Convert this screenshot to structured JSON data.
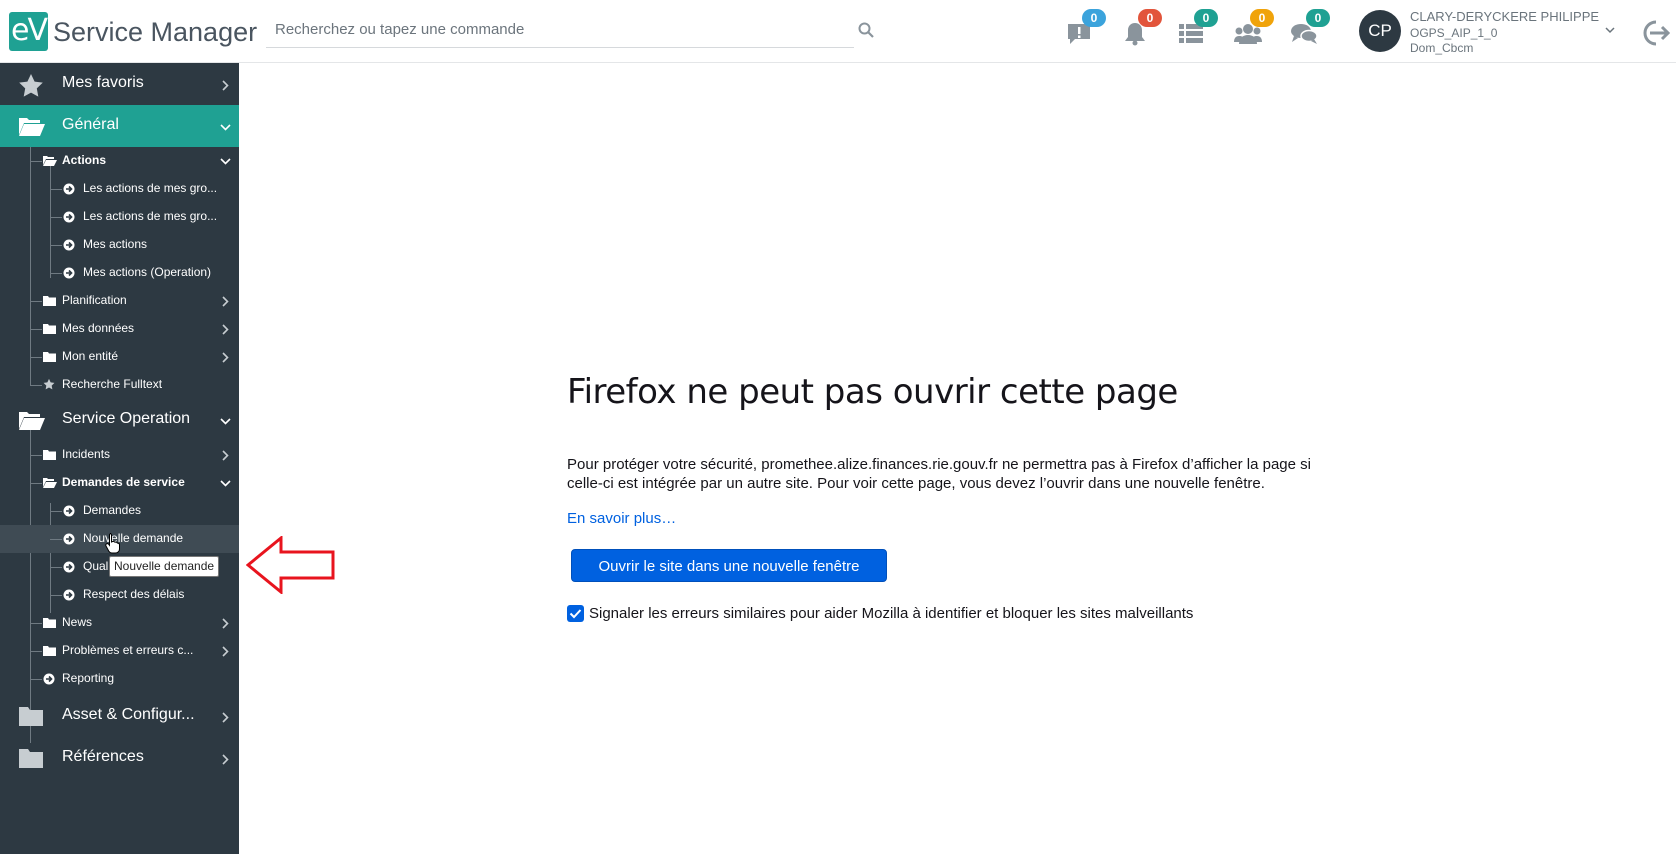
{
  "header": {
    "logo_text": "eV",
    "app_title": "Service Manager",
    "search_placeholder": "Recherchez ou tapez une commande",
    "notifications": [
      {
        "icon": "alert-bubble-icon",
        "count": "0",
        "color": "#3ba3dc"
      },
      {
        "icon": "bell-icon",
        "count": "0",
        "color": "#e2543b"
      },
      {
        "icon": "list-icon",
        "count": "0",
        "color": "#1fa193"
      },
      {
        "icon": "users-icon",
        "count": "0",
        "color": "#f0a30a"
      },
      {
        "icon": "chat-icon",
        "count": "0",
        "color": "#1fa193"
      }
    ],
    "user": {
      "initials": "CP",
      "name": "CLARY-DERYCKERE PHILIPPE",
      "line2": "OGPS_AIP_1_0",
      "line3": "Dom_Cbcm"
    }
  },
  "sidebar": {
    "favorites": "Mes favoris",
    "general": "Général",
    "actions": "Actions",
    "actions_items": [
      "Les actions de mes gro...",
      "Les actions de mes gro...",
      "Mes actions",
      "Mes actions (Operation)"
    ],
    "planification": "Planification",
    "mes_donnees": "Mes données",
    "mon_entite": "Mon entité",
    "recherche": "Recherche Fulltext",
    "service_operation": "Service Operation",
    "incidents": "Incidents",
    "demandes_service": "Demandes de service",
    "demandes": "Demandes",
    "nouvelle_demande": "Nouvelle demande",
    "qualite": "Qual",
    "respect": "Respect des délais",
    "news": "News",
    "problemes": "Problèmes et erreurs c...",
    "reporting": "Reporting",
    "asset": "Asset & Configur...",
    "references": "Références"
  },
  "tooltip": "Nouvelle demande",
  "error_page": {
    "title": "Firefox ne peut pas ouvrir cette page",
    "text": "Pour protéger votre sécurité, promethee.alize.finances.rie.gouv.fr ne permettra pas à Firefox d’afficher la page si celle-ci est intégrée par un autre site. Pour voir cette page, vous devez l’ouvrir dans une nouvelle fenêtre.",
    "link": "En savoir plus…",
    "button": "Ouvrir le site dans une nouvelle fenêtre",
    "checkbox_label": "Signaler les erreurs similaires pour aider Mozilla à identifier et bloquer les sites malveillants",
    "checkbox_checked": true
  },
  "colors": {
    "accent": "#1fa193",
    "sidebar": "#2d3942",
    "firefox_blue": "#0061e0",
    "annotation_arrow": "#e8141e"
  }
}
